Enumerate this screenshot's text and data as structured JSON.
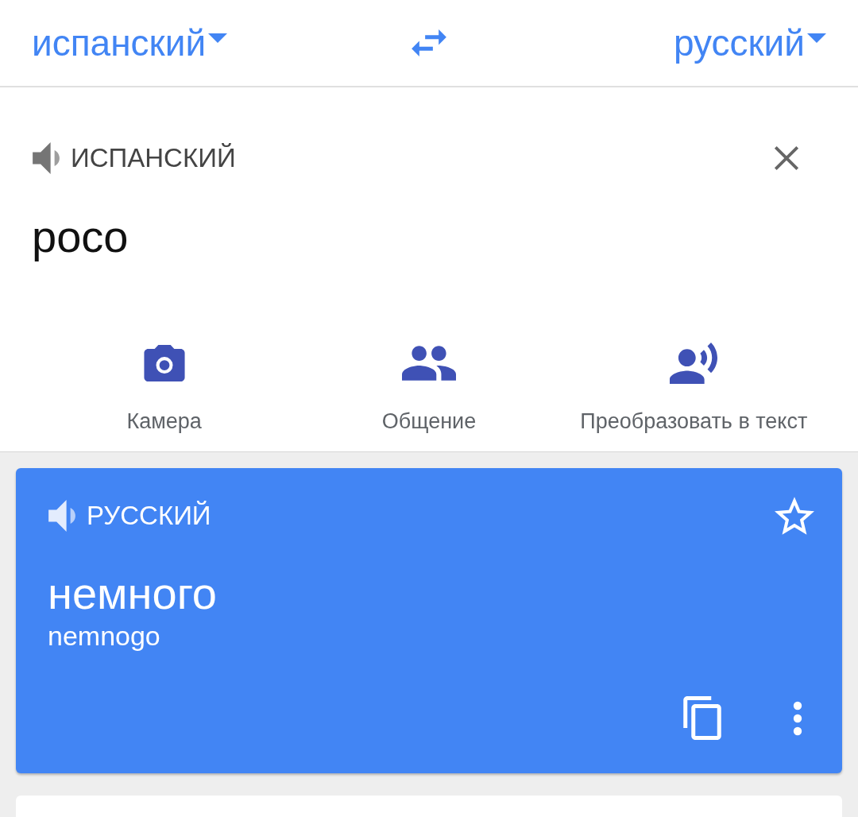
{
  "language_bar": {
    "source_language": "испанский",
    "target_language": "русский"
  },
  "input": {
    "language_label": "ИСПАНСКИЙ",
    "text": "poco"
  },
  "actions": [
    {
      "kind": "camera",
      "label": "Камера"
    },
    {
      "kind": "conversation",
      "label": "Общение"
    },
    {
      "kind": "transcribe",
      "label": "Преобразовать в текст"
    }
  ],
  "result": {
    "language_label": "РУССКИЙ",
    "translation": "немного",
    "transliteration": "nemnogo",
    "starred": false
  }
}
